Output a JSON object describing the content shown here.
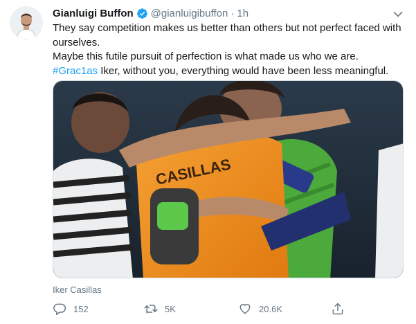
{
  "tweet": {
    "author_name": "Gianluigi Buffon",
    "handle": "@gianluigibuffon",
    "separator": "·",
    "time": "1h",
    "line1": "They say competition makes us better than others but not perfect faced with ourselves.",
    "line2": "Maybe this futile pursuit of perfection is what made us who we are.",
    "hashtag": "#Grac1as",
    "line3_rest": " Iker, without you, everything would have been less meaningful.",
    "photo_caption": "Iker Casillas"
  },
  "actions": {
    "reply_count": "152",
    "retweet_count": "5K",
    "like_count": "20.6K"
  },
  "icons": {
    "verified": "verified-badge-icon",
    "more": "chevron-down-icon",
    "reply": "reply-icon",
    "retweet": "retweet-icon",
    "like": "heart-icon",
    "share": "share-icon"
  },
  "colors": {
    "accent": "#1da1f2",
    "secondary_text": "#657786",
    "primary_text": "#14171a"
  }
}
